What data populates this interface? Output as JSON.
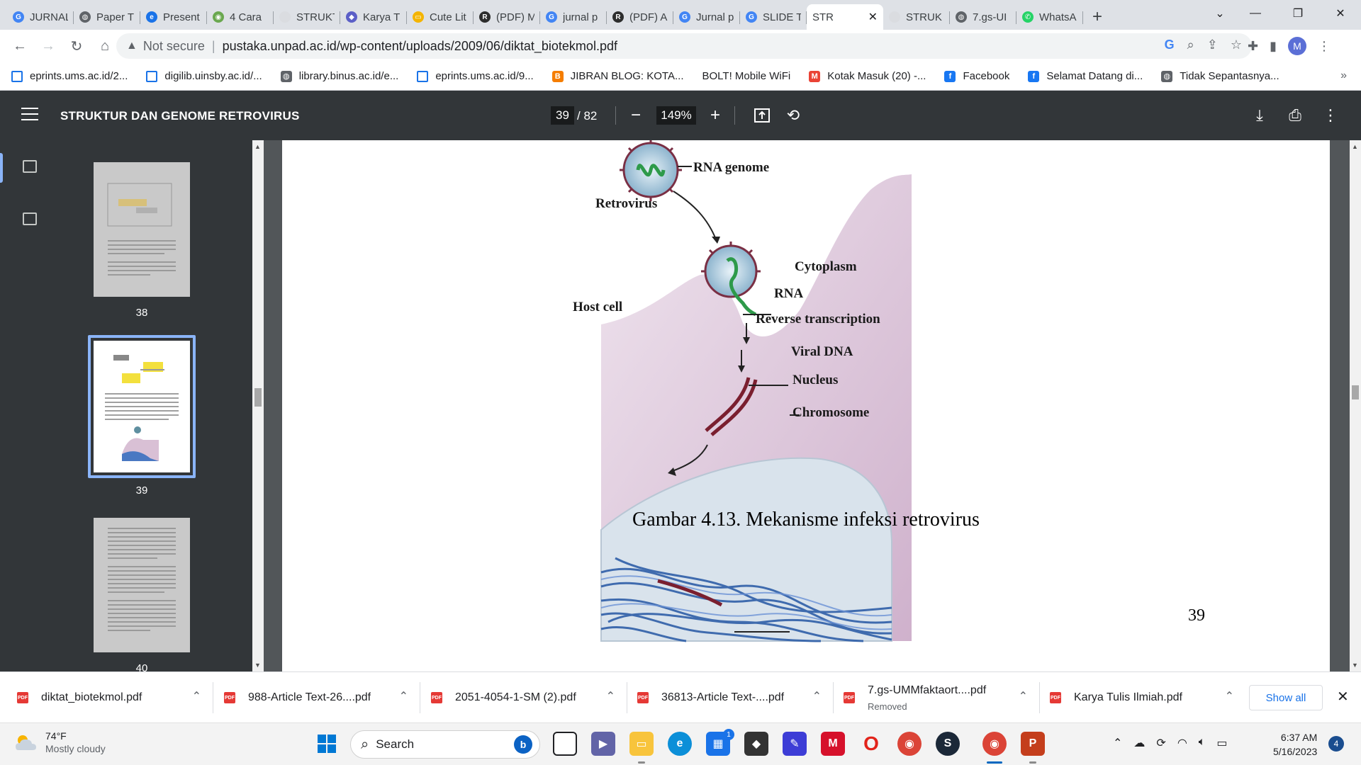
{
  "tabs": [
    {
      "title": "JURNAL",
      "favicon": "google-icon",
      "color": "#4285f4",
      "glyph": "G"
    },
    {
      "title": "Paper T",
      "favicon": "globe-icon",
      "color": "#5f6368",
      "glyph": "◍"
    },
    {
      "title": "Present",
      "favicon": "edge-icon",
      "color": "#1a73e8",
      "glyph": "e"
    },
    {
      "title": "4 Cara",
      "favicon": "site-icon",
      "color": "#6aa84f",
      "glyph": "◉"
    },
    {
      "title": "STRUKT",
      "favicon": "loading-icon",
      "color": "#dadce0",
      "glyph": ""
    },
    {
      "title": "Karya T",
      "favicon": "chat-icon",
      "color": "#5b5fc7",
      "glyph": "◆"
    },
    {
      "title": "Cute Lit",
      "favicon": "slides-icon",
      "color": "#f4b400",
      "glyph": "▭"
    },
    {
      "title": "(PDF) M",
      "favicon": "researchgate-icon",
      "color": "#2d2d2d",
      "glyph": "R"
    },
    {
      "title": "jurnal p",
      "favicon": "google-icon",
      "color": "#4285f4",
      "glyph": "G"
    },
    {
      "title": "(PDF) A",
      "favicon": "researchgate-icon",
      "color": "#2d2d2d",
      "glyph": "R"
    },
    {
      "title": "Jurnal p",
      "favicon": "google-icon",
      "color": "#4285f4",
      "glyph": "G"
    },
    {
      "title": "SLIDE T",
      "favicon": "google-icon",
      "color": "#4285f4",
      "glyph": "G"
    },
    {
      "title": "STR",
      "favicon": "none",
      "color": "#ffffff",
      "glyph": "",
      "active": true
    },
    {
      "title": "STRUK",
      "favicon": "loading-icon",
      "color": "#dadce0",
      "glyph": ""
    },
    {
      "title": "7.gs-UI",
      "favicon": "globe-icon",
      "color": "#5f6368",
      "glyph": "◍"
    },
    {
      "title": "WhatsA",
      "favicon": "whatsapp-icon",
      "color": "#25d366",
      "glyph": "✆"
    }
  ],
  "address": {
    "security": "Not secure",
    "url": "pustaka.unpad.ac.id/wp-content/uploads/2009/06/diktat_biotekmol.pdf"
  },
  "profile_initial": "M",
  "bookmarks": [
    {
      "label": "eprints.ums.ac.id/2...",
      "icon": "doc-icon",
      "color": "#1a73e8",
      "glyph": ""
    },
    {
      "label": "digilib.uinsby.ac.id/...",
      "icon": "doc-icon",
      "color": "#1a73e8",
      "glyph": ""
    },
    {
      "label": "library.binus.ac.id/e...",
      "icon": "globe-icon",
      "color": "#5f6368",
      "glyph": "◍"
    },
    {
      "label": "eprints.ums.ac.id/9...",
      "icon": "doc-icon",
      "color": "#1a73e8",
      "glyph": ""
    },
    {
      "label": "JIBRAN BLOG: KOTA...",
      "icon": "blogger-icon",
      "color": "#f57d00",
      "glyph": "B"
    },
    {
      "label": "BOLT! Mobile WiFi",
      "icon": "none",
      "color": "#ffffff",
      "glyph": ""
    },
    {
      "label": "Kotak Masuk (20) -...",
      "icon": "gmail-icon",
      "color": "#ea4335",
      "glyph": "M"
    },
    {
      "label": "Facebook",
      "icon": "facebook-icon",
      "color": "#1877f2",
      "glyph": "f"
    },
    {
      "label": "Selamat Datang di...",
      "icon": "facebook-icon",
      "color": "#1877f2",
      "glyph": "f"
    },
    {
      "label": "Tidak Sepantasnya...",
      "icon": "globe-icon",
      "color": "#5f6368",
      "glyph": "◍"
    }
  ],
  "pdf": {
    "title": "STRUKTUR DAN GENOME RETROVIRUS",
    "current_page": "39",
    "total_pages": "/ 82",
    "zoom": "149%",
    "thumbnails": [
      "38",
      "39",
      "40"
    ],
    "figure_labels": {
      "rna_genome": "RNA genome",
      "retrovirus": "Retrovirus",
      "cytoplasm": "Cytoplasm",
      "rna": "RNA",
      "host_cell": "Host cell",
      "reverse_transcription": "Reverse transcription",
      "viral_dna": "Viral DNA",
      "nucleus": "Nucleus",
      "chromosome": "Chromosome"
    },
    "caption": "Gambar 4.13. Mekanisme infeksi retrovirus",
    "page_number": "39"
  },
  "downloads": [
    {
      "name": "diktat_biotekmol.pdf",
      "status": ""
    },
    {
      "name": "988-Article Text-26....pdf",
      "status": ""
    },
    {
      "name": "2051-4054-1-SM (2).pdf",
      "status": ""
    },
    {
      "name": "36813-Article Text-....pdf",
      "status": ""
    },
    {
      "name": "7.gs-UMMfaktaort....pdf",
      "status": "Removed"
    },
    {
      "name": "Karya Tulis Ilmiah.pdf",
      "status": ""
    }
  ],
  "downloads_show_all": "Show all",
  "taskbar": {
    "temperature": "74°F",
    "weather": "Mostly cloudy",
    "search_placeholder": "Search",
    "time": "6:37 AM",
    "date": "5/16/2023",
    "notification_count": "4",
    "store_badge": "1"
  }
}
